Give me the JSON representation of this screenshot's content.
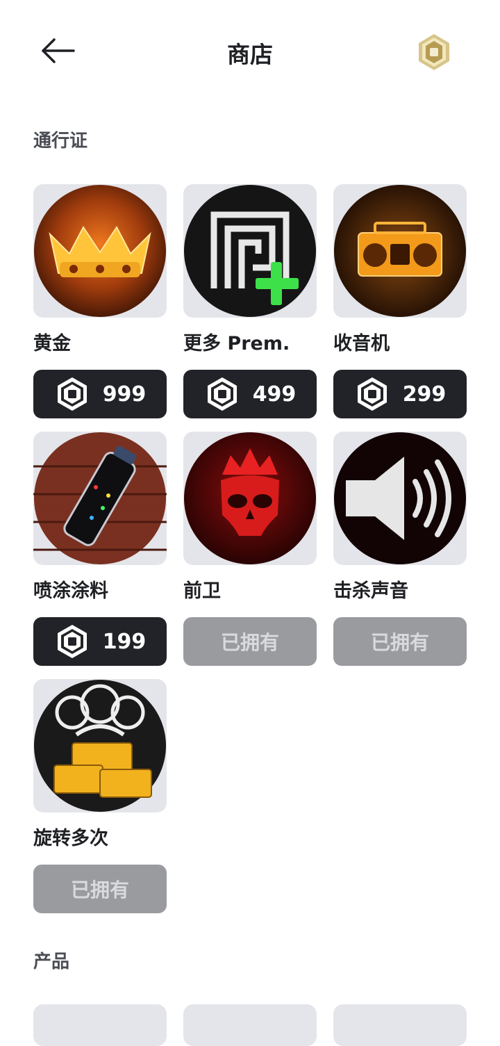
{
  "header": {
    "title": "商店"
  },
  "sections": {
    "passes": "通行证",
    "products": "产品"
  },
  "passes": [
    {
      "name": "黄金",
      "price": "999",
      "owned": false
    },
    {
      "name": "更多 Prem.",
      "price": "499",
      "owned": false
    },
    {
      "name": "收音机",
      "price": "299",
      "owned": false
    },
    {
      "name": "喷涂涂料",
      "price": "199",
      "owned": false
    },
    {
      "name": "前卫",
      "owned_label": "已拥有",
      "owned": true
    },
    {
      "name": "击杀声音",
      "owned_label": "已拥有",
      "owned": true
    },
    {
      "name": "旋转多次",
      "owned_label": "已拥有",
      "owned": true
    }
  ],
  "icons": {
    "back": "arrow-left-icon",
    "currency": "robux-icon",
    "pass_images": [
      "crown-icon",
      "premium-plus-icon",
      "boombox-icon",
      "spray-paint-icon",
      "skull-crown-icon",
      "speaker-icon",
      "spin-crates-icon"
    ]
  },
  "colors": {
    "price_button": "#222328",
    "owned_button": "#9a9b9f",
    "thumb_bg": "#e4e5ea",
    "text": "#1f2024",
    "section_text": "#4b4d55",
    "gold": "#c9a85a"
  }
}
